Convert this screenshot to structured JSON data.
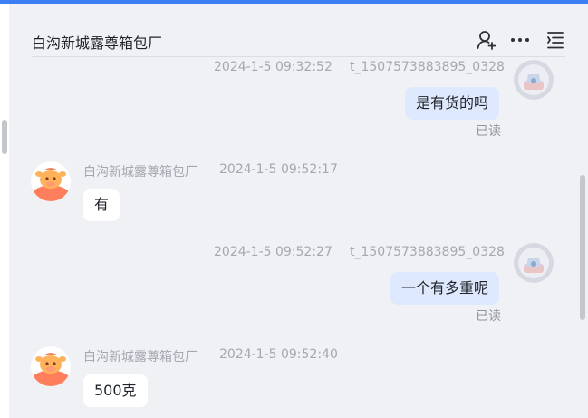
{
  "header": {
    "title": "白沟新城露尊箱包厂"
  },
  "icons": {
    "add_user": "add-user-icon",
    "more": "more-icon",
    "list": "list-icon"
  },
  "colors": {
    "accent": "#3d7ef5",
    "my_bubble": "#dfe9fd",
    "their_bubble": "#ffffff"
  },
  "messages": [
    {
      "timestamp": "2024-1-5 09:32:52",
      "sender": "t_1507573883895_0328",
      "text": "是有货的吗",
      "status": "已读"
    },
    {
      "timestamp": "2024-1-5 09:52:17",
      "sender": "白沟新城露尊箱包厂",
      "text": "有"
    },
    {
      "timestamp": "2024-1-5 09:52:27",
      "sender": "t_1507573883895_0328",
      "text": "一个有多重呢",
      "status": "已读"
    },
    {
      "timestamp": "2024-1-5 09:52:40",
      "sender": "白沟新城露尊箱包厂",
      "text": "500克"
    }
  ]
}
